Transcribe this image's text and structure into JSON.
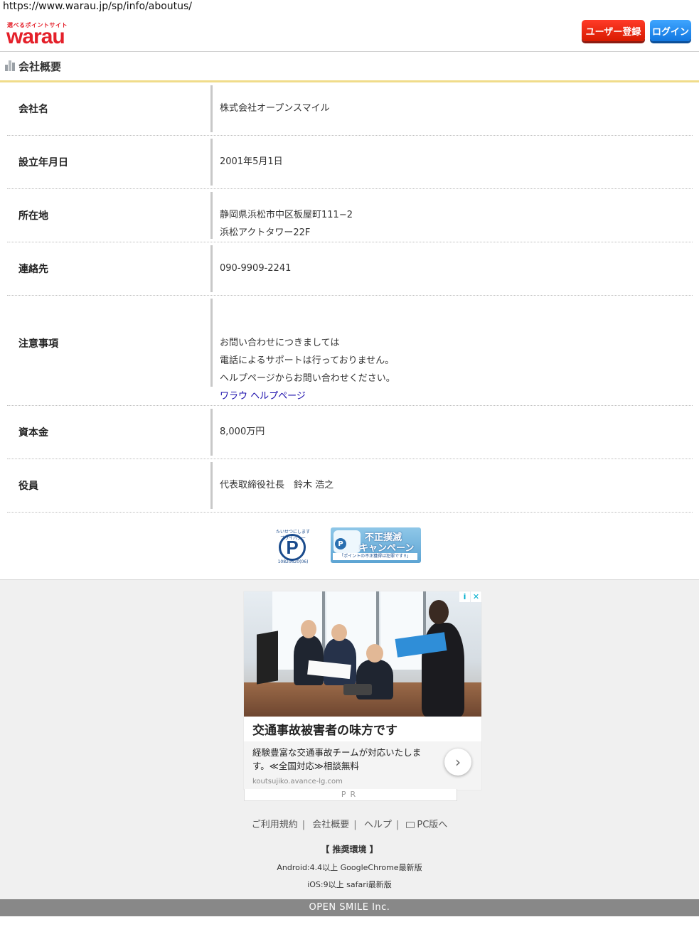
{
  "browser": {
    "url": "https://www.warau.jp/sp/info/aboutus/"
  },
  "header": {
    "logo_tagline": "選べるポイントサイト",
    "logo_text": "warau",
    "register_label": "ユーザー登録",
    "login_label": "ログイン"
  },
  "section": {
    "title": "会社概要"
  },
  "company": {
    "rows": [
      {
        "label": "会社名",
        "lines": [
          "株式会社オープンスマイル"
        ]
      },
      {
        "label": "設立年月日",
        "lines": [
          "2001年5月1日"
        ]
      },
      {
        "label": "所在地",
        "lines": [
          "静岡県浜松市中区板屋町111−2",
          "浜松アクトタワー22F"
        ]
      },
      {
        "label": "連絡先",
        "lines": [
          "090-9909-2241"
        ]
      },
      {
        "label": "注意事項",
        "lines": [
          "お問い合わせにつきましては",
          "電話によるサポートは行っておりません。",
          "ヘルプページからお問い合わせください。"
        ],
        "link": "ワラウ ヘルプページ"
      },
      {
        "label": "資本金",
        "lines": [
          "8,000万円"
        ]
      },
      {
        "label": "役員",
        "lines": [
          "代表取締役社長　鈴木 浩之"
        ]
      }
    ]
  },
  "badges": {
    "privacy_top": "たいせつにしますプライバシー",
    "privacy_letter": "P",
    "privacy_number": "10820620(06)",
    "campaign_line1": "不正撲滅",
    "campaign_line2": "キャンペーン",
    "campaign_note": "「ポイントの不正獲得は犯罪です!!」"
  },
  "ad": {
    "info_icon": "i",
    "close_icon": "✕",
    "title": "交通事故被害者の味方です",
    "description": "経験豊富な交通事故チームが対応いたします。≪全国対応≫相談無料",
    "domain": "koutsujiko.avance-lg.com",
    "arrow": "›",
    "pr_label": "PR"
  },
  "footer": {
    "links": [
      "ご利用規約",
      "会社概要",
      "ヘルプ",
      "PC版へ"
    ],
    "separator": "|",
    "env_title": "【 推奨環境 】",
    "env_android": "Android:4.4以上 GoogleChrome最新版",
    "env_ios": "iOS:9以上 safari最新版",
    "copyright": "OPEN SMILE Inc."
  },
  "colors": {
    "brand_red": "#e4202a",
    "register_button": "#e8230c",
    "login_button": "#2a8ef0",
    "section_underline": "#f0dc8a",
    "footer_bar": "#888888",
    "link": "#1a0dab"
  }
}
